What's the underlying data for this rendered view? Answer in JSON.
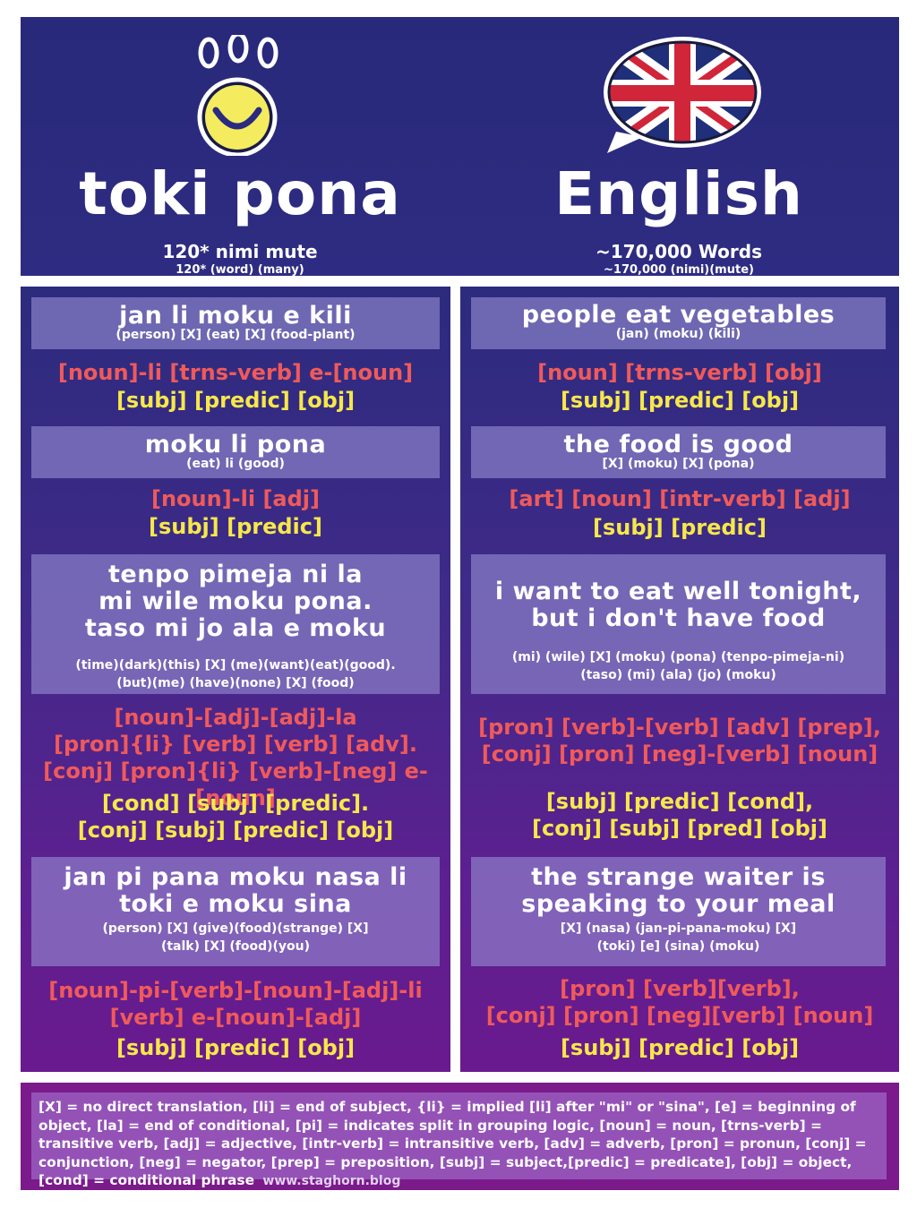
{
  "header": {
    "left": {
      "logo_icon": "toki-pona-smiley-logo",
      "title": "toki pona",
      "subtitle": "120* nimi mute",
      "subtitle_gloss": "120* (word) (many)"
    },
    "right": {
      "logo_icon": "uk-flag-speech-bubble",
      "title": "English",
      "subtitle": "~170,000 Words",
      "subtitle_gloss": "~170,000 (nimi)(mute)"
    }
  },
  "colors": {
    "header_bg": "#2b2a7d",
    "pattern_text": "#f05a5a",
    "roles_text": "#f7e74a",
    "legend_bg": "#7b1a8b"
  },
  "left_examples": [
    {
      "sentence": "jan li moku e kili",
      "gloss": "(person) [X] (eat) [X] (food-plant)",
      "pattern": "[noun]-li [trns-verb] e-[noun]",
      "roles": "[subj] [predic] [obj]"
    },
    {
      "sentence": "moku li pona",
      "gloss": "(eat) li (good)",
      "pattern": "[noun]-li [adj]",
      "roles": "[subj] [predic]"
    },
    {
      "sentence": "tenpo pimeja ni la\nmi wile moku pona.\ntaso mi jo ala e moku",
      "gloss": "(time)(dark)(this) [X] (me)(want)(eat)(good).\n(but)(me) (have)(none) [X] (food)",
      "pattern": "[noun]-[adj]-[adj]-la\n[pron]{li} [verb] [verb] [adv].\n[conj] [pron]{li} [verb]-[neg] e-[noun]",
      "roles": "[cond] [subj] [predic].\n[conj] [subj] [predic] [obj]"
    },
    {
      "sentence": "jan pi pana moku nasa li\ntoki e moku sina",
      "gloss": "(person) [X] (give)(food)(strange) [X]\n(talk) [X] (food)(you)",
      "pattern": "[noun]-pi-[verb]-[noun]-[adj]-li\n[verb] e-[noun]-[adj]",
      "roles": "[subj] [predic] [obj]"
    }
  ],
  "right_examples": [
    {
      "sentence": "people eat vegetables",
      "gloss": "(jan) (moku) (kili)",
      "pattern": "[noun] [trns-verb] [obj]",
      "roles": "[subj] [predic] [obj]"
    },
    {
      "sentence": "the food is good",
      "gloss": "[X] (moku) [X] (pona)",
      "pattern": "[art] [noun] [intr-verb] [adj]",
      "roles": "[subj] [predic]"
    },
    {
      "sentence": "i want to eat well tonight,\nbut i don't have food",
      "gloss": "(mi) (wile) [X] (moku) (pona) (tenpo-pimeja-ni)\n(taso) (mi) (ala) (jo) (moku)",
      "pattern": "[pron] [verb]-[verb] [adv] [prep],\n[conj] [pron] [neg]-[verb] [noun]",
      "roles": "[subj] [predic] [cond],\n[conj] [subj] [pred] [obj]"
    },
    {
      "sentence": "the strange waiter is\nspeaking to your meal",
      "gloss": "[X] (nasa) (jan-pi-pana-moku) [X]\n(toki) [e] (sina) (moku)",
      "pattern": "[pron] [verb][verb],\n[conj] [pron] [neg][verb] [noun]",
      "roles": "[subj] [predic] [obj]"
    }
  ],
  "legend": {
    "text": "[X] = no direct translation, [li] = end of subject, {li} = implied [li] after \"mi\" or \"sina\", [e] = beginning of object, [la] = end of conditional,  [pi] = indicates split in grouping logic,  [noun] = noun,  [trns-verb] = transitive verb, [adj] = adjective, [intr-verb] = intransitive verb, [adv] = adverb, [pron] = pronun, [conj] = conjunction, [neg] = negator, [prep] = preposition, [subj] = subject,[predic] = predicate], [obj] = object, [cond] = conditional phrase",
    "credit": "www.staghorn.blog"
  }
}
